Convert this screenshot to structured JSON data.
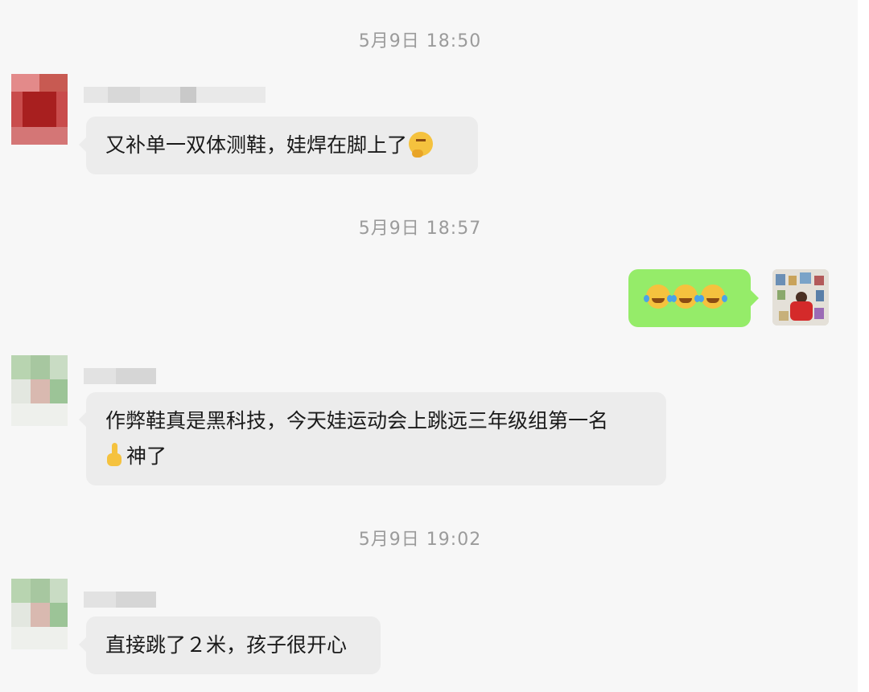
{
  "messages": [
    {
      "time": "5月9日 18:50",
      "text": "又补单一双体测鞋，娃焊在脚上了"
    },
    {
      "time": "5月9日 18:57"
    },
    {
      "text_line1": "作弊鞋真是黑科技，今天娃运动会上跳远三年级组第一名",
      "text_line2": "神了"
    },
    {
      "time": "5月9日 19:02",
      "text": "直接跳了２米，孩子很开心"
    }
  ],
  "icons": {
    "msg1_emoji": "thinking-face",
    "msg2_emoji": "rolling-on-floor-laughing",
    "msg3_emoji": "index-pointing-up"
  },
  "colors": {
    "background": "#f7f7f7",
    "incoming_bubble": "#ececec",
    "outgoing_bubble": "#95ec69",
    "timestamp_text": "#9b9b9b"
  }
}
